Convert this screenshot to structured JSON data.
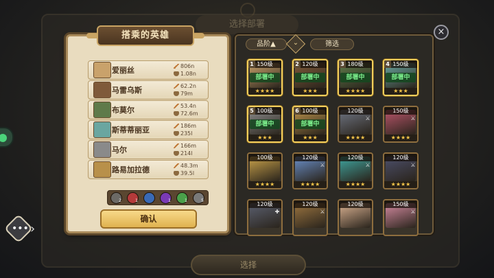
{
  "colors": {
    "accent_gold": "#f4cf5c",
    "panel_parchment": "#e9dcbf",
    "deploy_badge_green": "#7df08d",
    "star_yellow": "#f6c64a"
  },
  "background": {
    "title": "选择部署",
    "bottom_button_label": "选择"
  },
  "left_panel": {
    "title": "搭乘的英雄",
    "heroes": [
      {
        "name": "爱丽丝",
        "atk": "806n",
        "hp": "1.08n",
        "avatar_color": "#c9a26b"
      },
      {
        "name": "马雷乌斯",
        "atk": "62.2n",
        "hp": "79m",
        "avatar_color": "#7f5a3a"
      },
      {
        "name": "布莫尔",
        "atk": "53.4n",
        "hp": "72.6m",
        "avatar_color": "#5f7a4a"
      },
      {
        "name": "斯蒂蒂丽亚",
        "atk": "186m",
        "hp": "235l",
        "avatar_color": "#6aa6a0"
      },
      {
        "name": "马尔",
        "atk": "166m",
        "hp": "214l",
        "avatar_color": "#8a8a8a"
      },
      {
        "name": "路易加拉德",
        "atk": "48.3m",
        "hp": "39.5l",
        "avatar_color": "#b8904a"
      }
    ],
    "trait_counts": [
      "2",
      "1",
      "",
      "1",
      "1",
      "5"
    ],
    "confirm_label": "确认"
  },
  "right_panel": {
    "grade_sort_label": "品阶▲",
    "filter_label": "筛选",
    "close_icon": "×",
    "cards": [
      {
        "order": "1",
        "level": "150级",
        "badge": "部署中",
        "stars": "★★★★",
        "color": "#c9a26b",
        "selected": true,
        "cls": ""
      },
      {
        "order": "2",
        "level": "120级",
        "badge": "部署中",
        "stars": "★★★",
        "color": "#7f5a3a",
        "selected": true,
        "cls": ""
      },
      {
        "order": "3",
        "level": "180级",
        "badge": "部署中",
        "stars": "★★★★",
        "color": "#5f7a4a",
        "selected": true,
        "cls": ""
      },
      {
        "order": "4",
        "level": "150级",
        "badge": "部署中",
        "stars": "★★★",
        "color": "#6aa6a0",
        "selected": true,
        "cls": ""
      },
      {
        "order": "5",
        "level": "100级",
        "badge": "部署中",
        "stars": "★★★",
        "color": "#8a8a8a",
        "selected": true,
        "cls": ""
      },
      {
        "order": "6",
        "level": "100级",
        "badge": "部署中",
        "stars": "★★★",
        "color": "#b8904a",
        "selected": true,
        "cls": ""
      },
      {
        "order": "",
        "level": "120级",
        "badge": "",
        "stars": "★★★★",
        "color": "#6e7482",
        "selected": false,
        "cls": "⚔"
      },
      {
        "order": "",
        "level": "150级",
        "badge": "",
        "stars": "★★★★",
        "color": "#b9556a",
        "selected": false,
        "cls": "⚔"
      },
      {
        "order": "",
        "level": "100级",
        "badge": "",
        "stars": "★★★★",
        "color": "#c9a24a",
        "selected": false,
        "cls": ""
      },
      {
        "order": "",
        "level": "120级",
        "badge": "",
        "stars": "★★★★",
        "color": "#6a8fc9",
        "selected": false,
        "cls": "⚔"
      },
      {
        "order": "",
        "level": "120级",
        "badge": "",
        "stars": "★★★★",
        "color": "#3fa6a0",
        "selected": false,
        "cls": "⚔"
      },
      {
        "order": "",
        "level": "120级",
        "badge": "",
        "stars": "★★★★",
        "color": "#4c4f6a",
        "selected": false,
        "cls": "⚔"
      },
      {
        "order": "",
        "level": "120级",
        "badge": "",
        "stars": "",
        "color": "#5b6070",
        "selected": false,
        "cls": "✚"
      },
      {
        "order": "",
        "level": "120级",
        "badge": "",
        "stars": "",
        "color": "#9a7440",
        "selected": false,
        "cls": "⚔"
      },
      {
        "order": "",
        "level": "120级",
        "badge": "",
        "stars": "",
        "color": "#d8b090",
        "selected": false,
        "cls": ""
      },
      {
        "order": "",
        "level": "150级",
        "badge": "",
        "stars": "",
        "color": "#d48aa0",
        "selected": false,
        "cls": "⚔"
      }
    ]
  }
}
